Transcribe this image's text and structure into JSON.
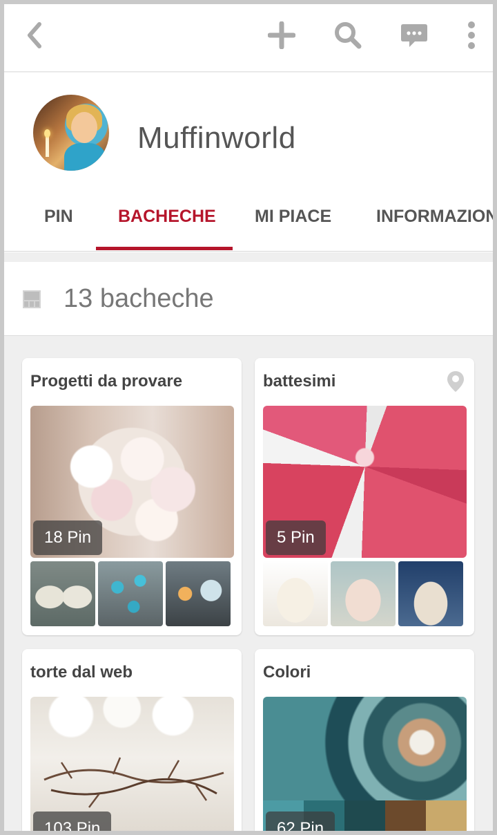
{
  "topbar": {
    "icons": [
      "back-icon",
      "plus-icon",
      "search-icon",
      "message-icon",
      "more-vertical-icon"
    ]
  },
  "profile": {
    "name": "Muffinworld"
  },
  "tabs": [
    {
      "label": "PIN",
      "active": false
    },
    {
      "label": "BACHECHE",
      "active": true
    },
    {
      "label": "MI PIACE",
      "active": false
    },
    {
      "label": "INFORMAZION",
      "active": false
    }
  ],
  "boards_header": {
    "count_label": "13 bacheche"
  },
  "boards": [
    {
      "title": "Progetti da provare",
      "pin_count": "18 Pin",
      "has_location": false
    },
    {
      "title": "battesimi",
      "pin_count": "5 Pin",
      "has_location": true
    },
    {
      "title": "torte dal web",
      "pin_count": "103 Pin",
      "has_location": false
    },
    {
      "title": "Colori",
      "pin_count": "62 Pin",
      "has_location": false
    }
  ],
  "colors": {
    "accent": "#b5152b",
    "icon_gray": "#aaaaaa",
    "text_dark": "#555555",
    "background": "#efefef",
    "palette_swatches": [
      "#4c9ba4",
      "#2b6f76",
      "#1f4a4f",
      "#6c4a2c",
      "#c9a96b"
    ]
  }
}
